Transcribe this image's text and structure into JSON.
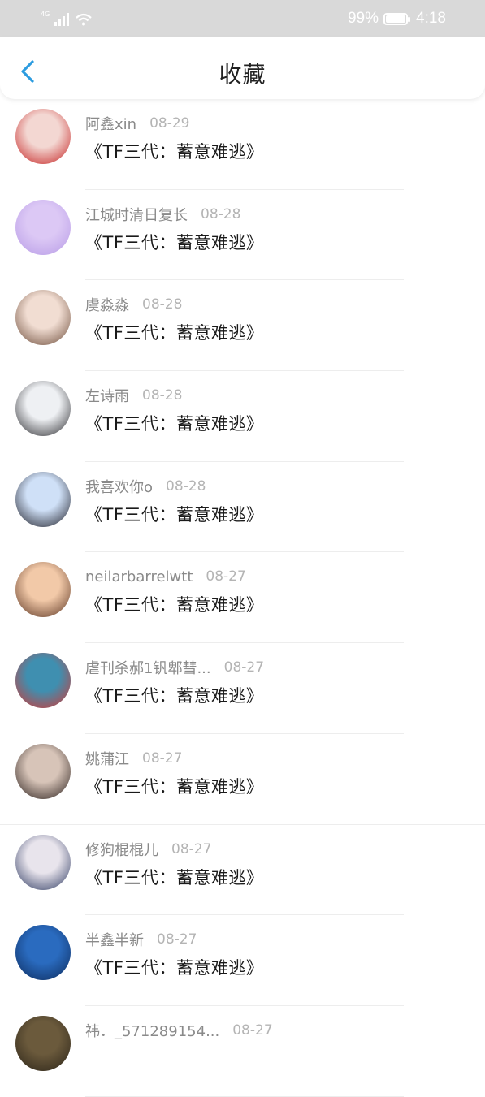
{
  "status_bar": {
    "network": "4G",
    "battery": "99%",
    "battery_level": 0.99,
    "time": "4:18"
  },
  "header": {
    "title": "收藏",
    "back_icon": "chevron-left-icon"
  },
  "colors": {
    "accent": "#2c9ce0",
    "status_bar_bg": "#d9d9d9"
  },
  "favorites": [
    {
      "user": "阿鑫xin",
      "date": "08-29",
      "title": "《TF三代：蓄意难逃》",
      "avatar_colors": [
        "#f3d7d2",
        "#c41f1f"
      ]
    },
    {
      "user": "江城时清日复长",
      "date": "08-28",
      "title": "《TF三代：蓄意难逃》",
      "avatar_colors": [
        "#dcc8f5",
        "#b79be6"
      ]
    },
    {
      "user": "虞淼淼",
      "date": "08-28",
      "title": "《TF三代：蓄意难逃》",
      "avatar_colors": [
        "#f1ddd2",
        "#6b4a38"
      ]
    },
    {
      "user": "左诗雨",
      "date": "08-28",
      "title": "《TF三代：蓄意难逃》",
      "avatar_colors": [
        "#eef0f3",
        "#2a2a2e"
      ]
    },
    {
      "user": "我喜欢你o",
      "date": "08-28",
      "title": "《TF三代：蓄意难逃》",
      "avatar_colors": [
        "#cfe0f7",
        "#1c1c25"
      ]
    },
    {
      "user": "neilarbarrelwtt",
      "date": "08-27",
      "title": "《TF三代：蓄意难逃》",
      "avatar_colors": [
        "#f2c9a8",
        "#5a3422"
      ]
    },
    {
      "user": "虐刊杀郝1钒郫彗...",
      "date": "08-27",
      "title": "《TF三代：蓄意难逃》",
      "avatar_colors": [
        "#3f8fb0",
        "#d8342f"
      ]
    },
    {
      "user": "姚蒲江",
      "date": "08-27",
      "title": "《TF三代：蓄意难逃》",
      "avatar_colors": [
        "#d7c4b8",
        "#2a1f1c"
      ]
    },
    {
      "user": "修狗棍棍儿",
      "date": "08-27",
      "title": "《TF三代：蓄意难逃》",
      "avatar_colors": [
        "#e8e4ec",
        "#2c3860"
      ]
    },
    {
      "user": "半鑫半新",
      "date": "08-27",
      "title": "《TF三代：蓄意难逃》",
      "avatar_colors": [
        "#2a6bbf",
        "#0d2a5a"
      ]
    },
    {
      "user": "祎．_571289154...",
      "date": "08-27",
      "title": "",
      "avatar_colors": [
        "#6b5a3c",
        "#2a2318"
      ]
    }
  ]
}
